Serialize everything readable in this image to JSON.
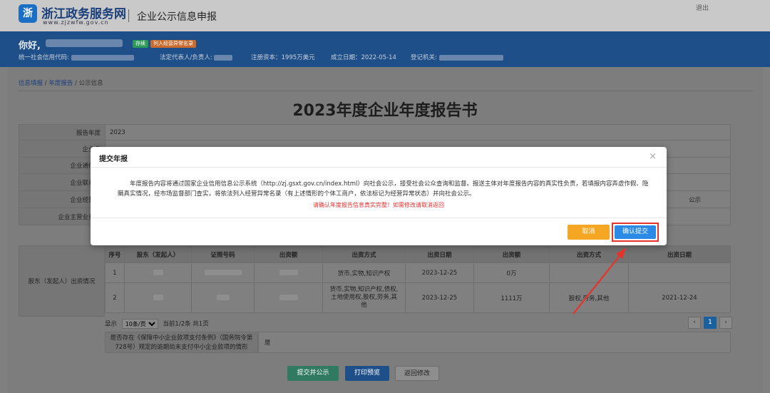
{
  "header": {
    "logo_glyph": "浙",
    "site_name": "浙江政务服务网",
    "site_url": "www.zjzwfw.gov.cn",
    "system_title": "企业公示信息申报",
    "logout": "退出"
  },
  "banner": {
    "greeting": "你好,",
    "tag_status": "存续",
    "tag_abnormal": "列入经营异常名录",
    "credit_code_label": "统一社会信用代码:",
    "legal_rep_label": "法定代表人/负责人:",
    "capital": "注册资本：1995万美元",
    "established": "成立日期：2022-05-14",
    "authority_label": "登记机关:"
  },
  "breadcrumb": {
    "item1": "信息填报",
    "item2": "年度报告",
    "item3": "公示信息",
    "sep": "/"
  },
  "report": {
    "title": "2023年度企业年度报告书",
    "year_label": "报告年度",
    "year_value": "2023",
    "row2_label": "企业名",
    "row3_label": "企业通信地",
    "row4_label": "企业联系电",
    "row5_label": "企业经营状",
    "row5_right": "公示",
    "row6_label": "企业主营业务活"
  },
  "shareholder": {
    "side_label": "股东（发起人）出资情况",
    "headers": [
      "序号",
      "股东（发起人）",
      "证照号码",
      "出资额",
      "出资方式",
      "出资日期",
      "出资额",
      "出资方式",
      "出资日期"
    ],
    "rows": [
      {
        "no": "1",
        "method": "货币,实物,知识产权",
        "date": "2023-12-25",
        "amount2": "0万",
        "method2": "",
        "date2": ""
      },
      {
        "no": "2",
        "method": "货币,实物,知识产权,债权,土地使用权,股权,劳务,其他",
        "date": "2023-12-25",
        "amount2": "1111万",
        "method2": "股权,劳务,其他",
        "date2": "2021-12-24"
      }
    ]
  },
  "pager": {
    "show": "显示",
    "page_size": "10条/页",
    "current": "当前1/2条 共1页",
    "prev": "‹",
    "page": "1",
    "next": "›"
  },
  "question": {
    "label": "是否存在《保障中小企业款项支付条例》（国务院令第728号）规定的逾期尚未支付中小企业款项的情形",
    "value": "是"
  },
  "bottom_buttons": {
    "submit": "提交并公示",
    "print": "打印预览",
    "back": "返回修改"
  },
  "modal": {
    "title": "提交年报",
    "close": "×",
    "body": "年度报告内容将通过国家企业信用信息公示系统（http://zj.gsxt.gov.cn/index.html）向社会公示，接受社会公众查询和监督。报送主体对年度报告内容的真实性负责，若填报内容弄虚作假、隐瞒真实情况，经市场监督部门查实，将依法列入经营异常名录（有上述情形的个体工商户，依法标记为经营异常状态）并向社会公示。",
    "warning": "请确认年度报告信息真实完整！如需修改请取消返回",
    "cancel": "取消",
    "confirm": "确认提交"
  },
  "colors": {
    "banner_blue": "#1f4f88",
    "confirm_blue": "#2b8ae6",
    "cancel_orange": "#f5a623",
    "highlight_red": "#e5332a",
    "warning_red": "#e0312f"
  }
}
